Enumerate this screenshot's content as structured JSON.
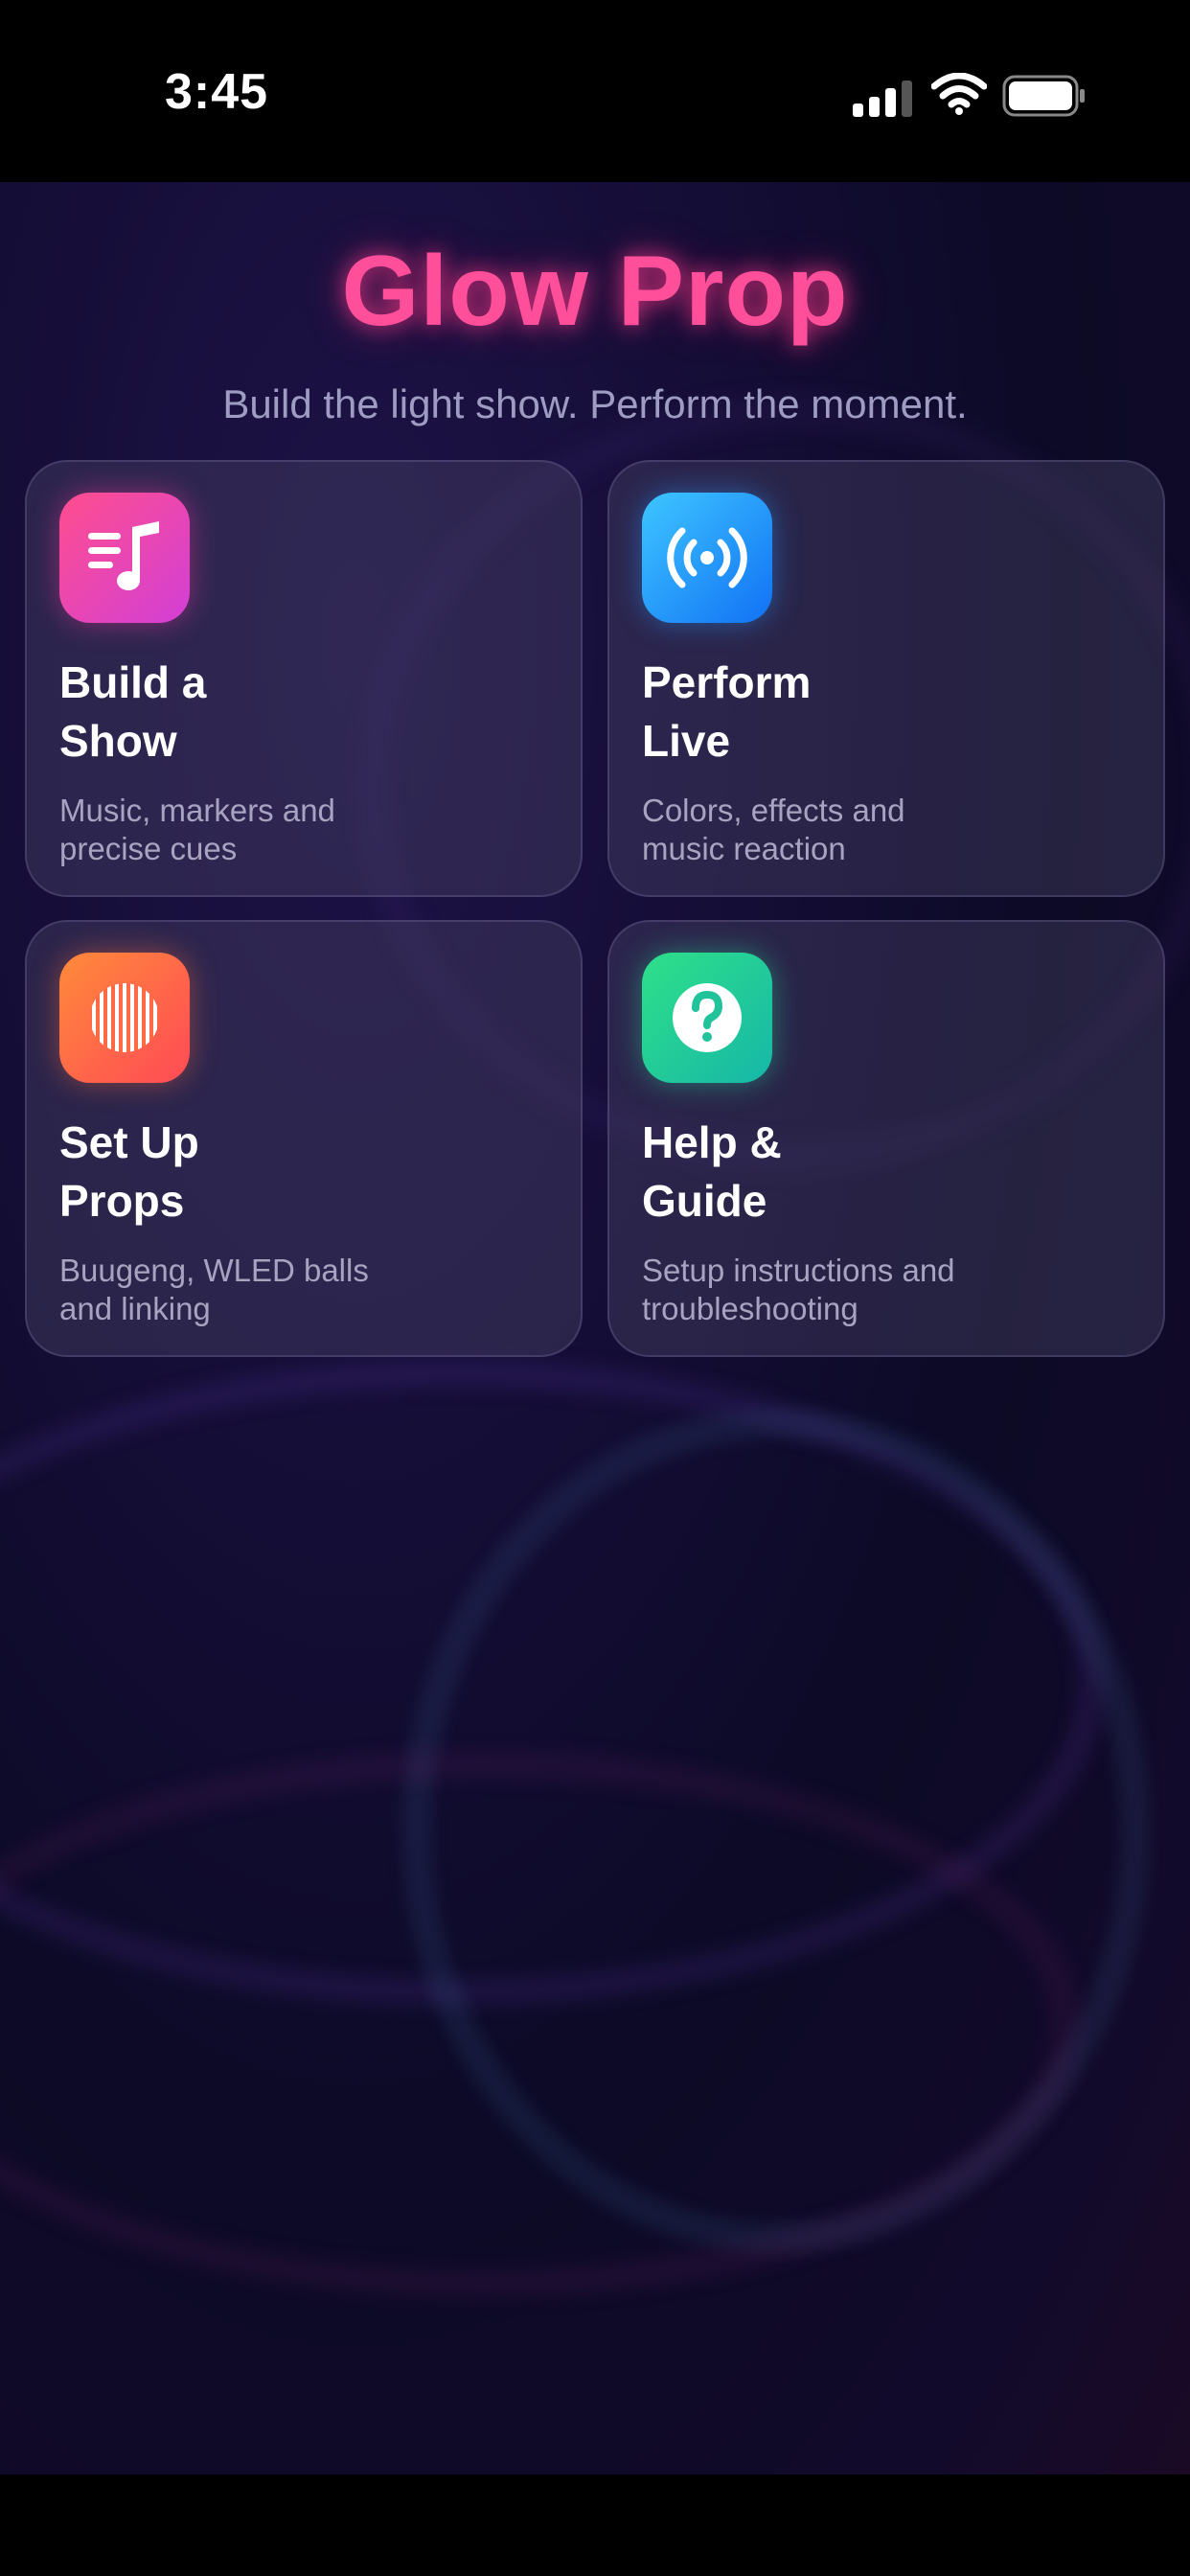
{
  "status_bar": {
    "time": "3:45"
  },
  "header": {
    "title": "Glow Prop",
    "subtitle": "Build the light show. Perform the moment."
  },
  "cards": [
    {
      "title": "Build a\nShow",
      "description": "Music, markers and\nprecise cues",
      "icon": "music-note-list-icon",
      "color": "#e83fa8"
    },
    {
      "title": "Perform\nLive",
      "description": "Colors, effects and\nmusic reaction",
      "icon": "broadcast-waves-icon",
      "color": "#1b9bff"
    },
    {
      "title": "Set Up\nProps",
      "description": "Buugeng, WLED balls\nand linking",
      "icon": "striped-ball-icon",
      "color": "#ff6a3d"
    },
    {
      "title": "Help &\nGuide",
      "description": "Setup instructions and\ntroubleshooting",
      "icon": "question-mark-icon",
      "color": "#22c98a"
    }
  ],
  "colors": {
    "accent": "#ff4f9a",
    "background": "#120d33"
  }
}
